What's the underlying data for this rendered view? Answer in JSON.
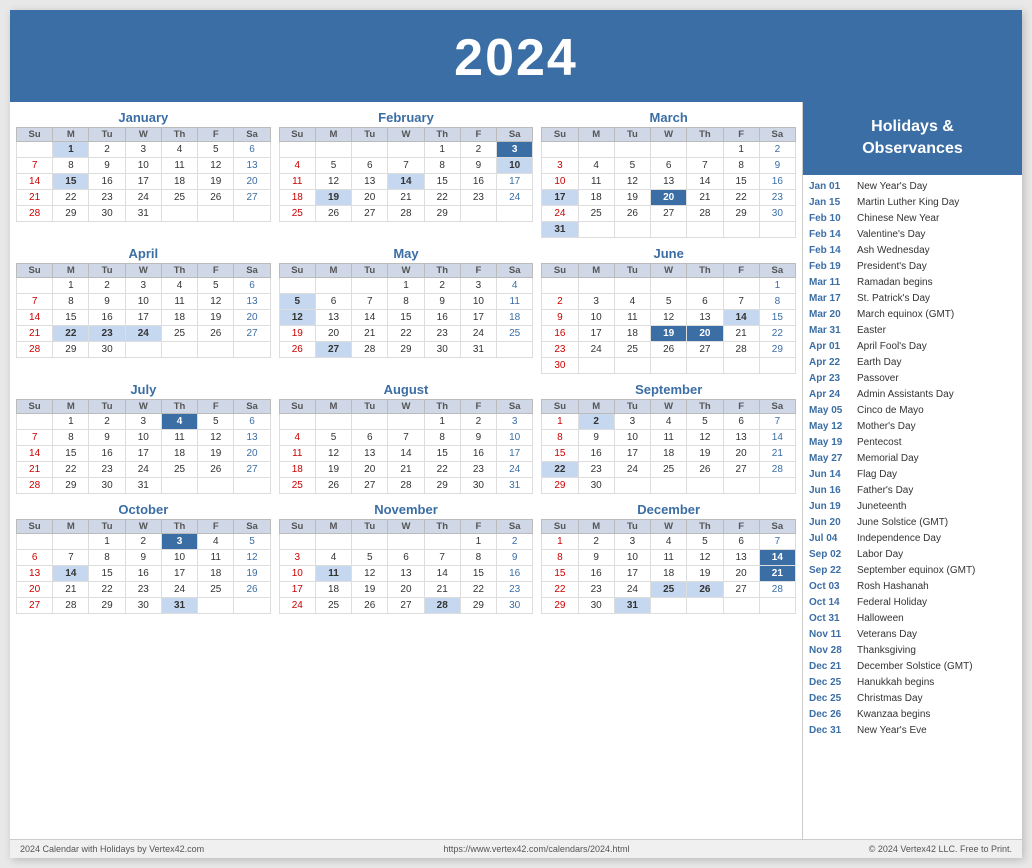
{
  "header": {
    "year": "2024"
  },
  "sidebar": {
    "title": "Holidays &\nObservances",
    "items": [
      {
        "date": "Jan 01",
        "event": "New Year's Day"
      },
      {
        "date": "Jan 15",
        "event": "Martin Luther King Day"
      },
      {
        "date": "Feb 10",
        "event": "Chinese New Year"
      },
      {
        "date": "Feb 14",
        "event": "Valentine's Day"
      },
      {
        "date": "Feb 14",
        "event": "Ash Wednesday"
      },
      {
        "date": "Feb 19",
        "event": "President's Day"
      },
      {
        "date": "Mar 11",
        "event": "Ramadan begins"
      },
      {
        "date": "Mar 17",
        "event": "St. Patrick's Day"
      },
      {
        "date": "Mar 20",
        "event": "March equinox (GMT)"
      },
      {
        "date": "Mar 31",
        "event": "Easter"
      },
      {
        "date": "Apr 01",
        "event": "April Fool's Day"
      },
      {
        "date": "Apr 22",
        "event": "Earth Day"
      },
      {
        "date": "Apr 23",
        "event": "Passover"
      },
      {
        "date": "Apr 24",
        "event": "Admin Assistants Day"
      },
      {
        "date": "May 05",
        "event": "Cinco de Mayo"
      },
      {
        "date": "May 12",
        "event": "Mother's Day"
      },
      {
        "date": "May 19",
        "event": "Pentecost"
      },
      {
        "date": "May 27",
        "event": "Memorial Day"
      },
      {
        "date": "Jun 14",
        "event": "Flag Day"
      },
      {
        "date": "Jun 16",
        "event": "Father's Day"
      },
      {
        "date": "Jun 19",
        "event": "Juneteenth"
      },
      {
        "date": "Jun 20",
        "event": "June Solstice (GMT)"
      },
      {
        "date": "Jul 04",
        "event": "Independence Day"
      },
      {
        "date": "Sep 02",
        "event": "Labor Day"
      },
      {
        "date": "Sep 22",
        "event": "September equinox (GMT)"
      },
      {
        "date": "Oct 03",
        "event": "Rosh Hashanah"
      },
      {
        "date": "Oct 14",
        "event": "Federal Holiday"
      },
      {
        "date": "Oct 31",
        "event": "Halloween"
      },
      {
        "date": "Nov 11",
        "event": "Veterans Day"
      },
      {
        "date": "Nov 28",
        "event": "Thanksgiving"
      },
      {
        "date": "Dec 21",
        "event": "December Solstice (GMT)"
      },
      {
        "date": "Dec 25",
        "event": "Hanukkah begins"
      },
      {
        "date": "Dec 25",
        "event": "Christmas Day"
      },
      {
        "date": "Dec 26",
        "event": "Kwanzaa begins"
      },
      {
        "date": "Dec 31",
        "event": "New Year's Eve"
      }
    ]
  },
  "footer": {
    "left": "2024 Calendar with Holidays by Vertex42.com",
    "center": "https://www.vertex42.com/calendars/2024.html",
    "right": "© 2024 Vertex42 LLC. Free to Print."
  },
  "months": [
    {
      "name": "January",
      "days": [
        [
          "",
          "1",
          "2",
          "3",
          "4",
          "5",
          "6"
        ],
        [
          "7",
          "8",
          "9",
          "10",
          "11",
          "12",
          "13"
        ],
        [
          "14",
          "15",
          "16",
          "17",
          "18",
          "19",
          "20"
        ],
        [
          "21",
          "22",
          "23",
          "24",
          "25",
          "26",
          "27"
        ],
        [
          "28",
          "29",
          "30",
          "31",
          "",
          "",
          ""
        ]
      ],
      "highlights": {
        "1": "holiday-blue",
        "15": "holiday-blue"
      }
    },
    {
      "name": "February",
      "days": [
        [
          "",
          "",
          "",
          "",
          "1",
          "2",
          "3"
        ],
        [
          "4",
          "5",
          "6",
          "7",
          "8",
          "9",
          "10"
        ],
        [
          "11",
          "12",
          "13",
          "14",
          "15",
          "16",
          "17"
        ],
        [
          "18",
          "19",
          "20",
          "21",
          "22",
          "23",
          "24"
        ],
        [
          "25",
          "26",
          "27",
          "28",
          "29",
          "",
          ""
        ]
      ],
      "highlights": {
        "3": "highlight-dark",
        "10": "holiday-blue",
        "14": "holiday-blue",
        "19": "holiday-blue"
      }
    },
    {
      "name": "March",
      "days": [
        [
          "",
          "",
          "",
          "",
          "",
          "1",
          "2"
        ],
        [
          "3",
          "4",
          "5",
          "6",
          "7",
          "8",
          "9"
        ],
        [
          "10",
          "11",
          "12",
          "13",
          "14",
          "15",
          "16"
        ],
        [
          "17",
          "18",
          "19",
          "20",
          "21",
          "22",
          "23"
        ],
        [
          "24",
          "25",
          "26",
          "27",
          "28",
          "29",
          "30"
        ],
        [
          "31",
          "",
          "",
          "",
          "",
          "",
          ""
        ]
      ],
      "highlights": {
        "17": "holiday-blue",
        "20": "highlight-dark",
        "31": "holiday-blue"
      }
    },
    {
      "name": "April",
      "days": [
        [
          "",
          "1",
          "2",
          "3",
          "4",
          "5",
          "6"
        ],
        [
          "7",
          "8",
          "9",
          "10",
          "11",
          "12",
          "13"
        ],
        [
          "14",
          "15",
          "16",
          "17",
          "18",
          "19",
          "20"
        ],
        [
          "21",
          "22",
          "23",
          "24",
          "25",
          "26",
          "27"
        ],
        [
          "28",
          "29",
          "30",
          "",
          "",
          "",
          ""
        ]
      ],
      "highlights": {
        "22": "holiday-blue",
        "23": "holiday-blue",
        "24": "holiday-blue"
      }
    },
    {
      "name": "May",
      "days": [
        [
          "",
          "",
          "",
          "1",
          "2",
          "3",
          "4"
        ],
        [
          "5",
          "6",
          "7",
          "8",
          "9",
          "10",
          "11"
        ],
        [
          "12",
          "13",
          "14",
          "15",
          "16",
          "17",
          "18"
        ],
        [
          "19",
          "20",
          "21",
          "22",
          "23",
          "24",
          "25"
        ],
        [
          "26",
          "27",
          "28",
          "29",
          "30",
          "31",
          ""
        ]
      ],
      "highlights": {
        "5": "holiday-blue",
        "12": "holiday-blue",
        "27": "holiday-blue"
      }
    },
    {
      "name": "June",
      "days": [
        [
          "",
          "",
          "",
          "",
          "",
          "",
          "1"
        ],
        [
          "2",
          "3",
          "4",
          "5",
          "6",
          "7",
          "8"
        ],
        [
          "9",
          "10",
          "11",
          "12",
          "13",
          "14",
          "15"
        ],
        [
          "16",
          "17",
          "18",
          "19",
          "20",
          "21",
          "22"
        ],
        [
          "23",
          "24",
          "25",
          "26",
          "27",
          "28",
          "29"
        ],
        [
          "30",
          "",
          "",
          "",
          "",
          "",
          ""
        ]
      ],
      "highlights": {
        "14": "holiday-blue",
        "19": "highlight-dark",
        "20": "highlight-dark"
      }
    },
    {
      "name": "July",
      "days": [
        [
          "",
          "1",
          "2",
          "3",
          "4",
          "5",
          "6"
        ],
        [
          "7",
          "8",
          "9",
          "10",
          "11",
          "12",
          "13"
        ],
        [
          "14",
          "15",
          "16",
          "17",
          "18",
          "19",
          "20"
        ],
        [
          "21",
          "22",
          "23",
          "24",
          "25",
          "26",
          "27"
        ],
        [
          "28",
          "29",
          "30",
          "31",
          "",
          "",
          ""
        ]
      ],
      "highlights": {
        "4": "highlight-dark"
      }
    },
    {
      "name": "August",
      "days": [
        [
          "",
          "",
          "",
          "",
          "1",
          "2",
          "3"
        ],
        [
          "4",
          "5",
          "6",
          "7",
          "8",
          "9",
          "10"
        ],
        [
          "11",
          "12",
          "13",
          "14",
          "15",
          "16",
          "17"
        ],
        [
          "18",
          "19",
          "20",
          "21",
          "22",
          "23",
          "24"
        ],
        [
          "25",
          "26",
          "27",
          "28",
          "29",
          "30",
          "31"
        ]
      ],
      "highlights": {}
    },
    {
      "name": "September",
      "days": [
        [
          "1",
          "2",
          "3",
          "4",
          "5",
          "6",
          "7"
        ],
        [
          "8",
          "9",
          "10",
          "11",
          "12",
          "13",
          "14"
        ],
        [
          "15",
          "16",
          "17",
          "18",
          "19",
          "20",
          "21"
        ],
        [
          "22",
          "23",
          "24",
          "25",
          "26",
          "27",
          "28"
        ],
        [
          "29",
          "30",
          "",
          "",
          "",
          "",
          ""
        ]
      ],
      "highlights": {
        "2": "holiday-blue",
        "22": "holiday-blue"
      }
    },
    {
      "name": "October",
      "days": [
        [
          "",
          "",
          "1",
          "2",
          "3",
          "4",
          "5"
        ],
        [
          "6",
          "7",
          "8",
          "9",
          "10",
          "11",
          "12"
        ],
        [
          "13",
          "14",
          "15",
          "16",
          "17",
          "18",
          "19"
        ],
        [
          "20",
          "21",
          "22",
          "23",
          "24",
          "25",
          "26"
        ],
        [
          "27",
          "28",
          "29",
          "30",
          "31",
          "",
          ""
        ]
      ],
      "highlights": {
        "3": "highlight-dark",
        "14": "holiday-blue",
        "31": "holiday-blue"
      }
    },
    {
      "name": "November",
      "days": [
        [
          "",
          "",
          "",
          "",
          "",
          "1",
          "2"
        ],
        [
          "3",
          "4",
          "5",
          "6",
          "7",
          "8",
          "9"
        ],
        [
          "10",
          "11",
          "12",
          "13",
          "14",
          "15",
          "16"
        ],
        [
          "17",
          "18",
          "19",
          "20",
          "21",
          "22",
          "23"
        ],
        [
          "24",
          "25",
          "26",
          "27",
          "28",
          "29",
          "30"
        ]
      ],
      "highlights": {
        "11": "holiday-blue",
        "28": "holiday-blue"
      }
    },
    {
      "name": "December",
      "days": [
        [
          "1",
          "2",
          "3",
          "4",
          "5",
          "6",
          "7"
        ],
        [
          "8",
          "9",
          "10",
          "11",
          "12",
          "13",
          "14"
        ],
        [
          "15",
          "16",
          "17",
          "18",
          "19",
          "20",
          "21"
        ],
        [
          "22",
          "23",
          "24",
          "25",
          "26",
          "27",
          "28"
        ],
        [
          "29",
          "30",
          "31",
          "",
          "",
          "",
          ""
        ]
      ],
      "highlights": {
        "14": "highlight-dark",
        "21": "highlight-dark",
        "25": "holiday-blue",
        "26": "holiday-blue",
        "31": "holiday-blue"
      }
    }
  ]
}
